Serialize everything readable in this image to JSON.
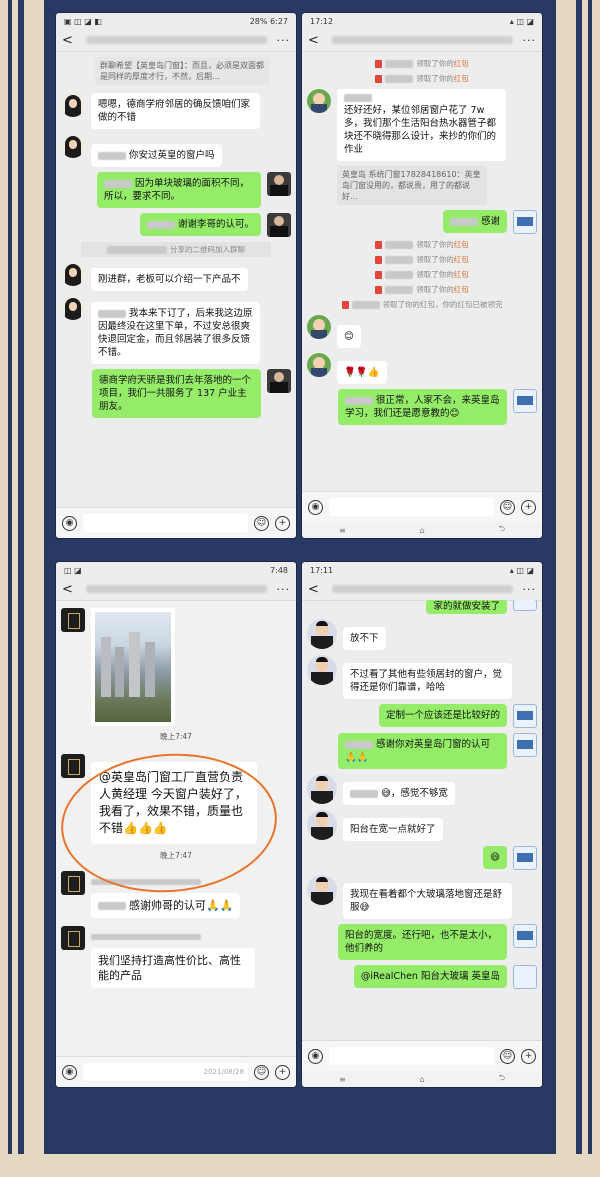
{
  "colors": {
    "frame": "#283a63",
    "cream": "#e6d9c3",
    "bubble_green": "#95ec69",
    "annotation": "#e8742a"
  },
  "phone1": {
    "status": {
      "time": "6:27",
      "battery": "28%"
    },
    "top_quote": "群聊希望【英皇岛门窗】：而且，必须是双面都是同样的厚度才行，不然，后期…",
    "messages": [
      {
        "side": "left",
        "text": "嗯嗯，德商学府邻居的确反馈咱们家做的不错"
      },
      {
        "side": "left",
        "text": "你安过英皇的窗户吗"
      },
      {
        "side": "right",
        "text": "因为单块玻璃的面积不同，所以，要求不同。"
      },
      {
        "side": "right",
        "text": "谢谢李哥的认可。"
      },
      {
        "side": "system",
        "text": "分享的二维码加入群聊"
      },
      {
        "side": "left",
        "text": "刚进群，老板可以介绍一下产品不"
      },
      {
        "side": "left",
        "text": "我本来下订了，后来我这边原因最终没在这里下单，不过安总很爽快退回定金，而且邻居装了很多反馈不错。"
      },
      {
        "side": "right",
        "text": "德商学府天骄是我们去年落地的一个项目，我们一共服务了 137 户业主朋友。"
      }
    ]
  },
  "phone2": {
    "status": {
      "time": "17:12"
    },
    "messages": [
      {
        "side": "sys",
        "text": "领取了你的",
        "hb": "红包"
      },
      {
        "side": "sys",
        "text": "领取了你的",
        "hb": "红包"
      },
      {
        "side": "left",
        "text": "还好还好，某位邻居窗户花了 7w 多，我们那个生活阳台热水器管子都块还不晓得那么设计，来抄的你们的作业"
      },
      {
        "side": "quote",
        "text": "英皇岛 系统门窗17828418610：英皇岛门窗没用的，都说贵，用了的都说好…"
      },
      {
        "side": "right",
        "text": "感谢"
      },
      {
        "side": "sys",
        "text": "领取了你的",
        "hb": "红包"
      },
      {
        "side": "sys",
        "text": "领取了你的",
        "hb": "红包"
      },
      {
        "side": "sys",
        "text": "领取了你的",
        "hb": "红包"
      },
      {
        "side": "sys",
        "text": "领取了你的",
        "hb": "红包"
      },
      {
        "side": "sys",
        "text": "领取了你的红包，你的红包已被领完",
        "hb": ""
      },
      {
        "side": "left",
        "text": "😊"
      },
      {
        "side": "left",
        "text": "🌹🌹👍"
      },
      {
        "side": "right",
        "text": "很正常，人家不会，来英皇岛学习，我们还是愿意教的😊"
      }
    ]
  },
  "phone3": {
    "status": {
      "time": "7:48"
    },
    "time1": "晚上7:47",
    "annotated_msg": "@英皇岛门窗工厂直营负责人黄经理 今天窗户装好了，我看了，效果不错，质量也不错👍👍👍",
    "time2": "晚上7:47",
    "messages": [
      {
        "side": "left",
        "text": "感谢帅哥的认可🙏🙏"
      },
      {
        "side": "left",
        "text": "我们坚持打造高性价比、高性能的产品"
      }
    ],
    "footer_date": "2021/08/28"
  },
  "phone4": {
    "status": {
      "time": "17:11"
    },
    "messages": [
      {
        "side": "right",
        "text": "家的就做安装了"
      },
      {
        "side": "left",
        "text": "放不下"
      },
      {
        "side": "left",
        "text": "不过看了其他有些领居封的窗户，觉得还是你们靠谱，哈哈"
      },
      {
        "side": "right",
        "text": "定制一个应该还是比较好的"
      },
      {
        "side": "right",
        "text": "感谢你对英皇岛门窗的认可🙏🙏"
      },
      {
        "side": "left",
        "text": "😅，感觉不够宽"
      },
      {
        "side": "left",
        "text": "阳台在宽一点就好了"
      },
      {
        "side": "right",
        "text": "😄"
      },
      {
        "side": "left",
        "text": "我现在看着都个大玻璃落地窗还是舒服😅"
      },
      {
        "side": "right",
        "text": "阳台的宽度。还行吧，也不是太小，他们养的"
      },
      {
        "side": "right",
        "text": "@iRealChen 阳台大玻璃 英皇岛"
      }
    ]
  }
}
